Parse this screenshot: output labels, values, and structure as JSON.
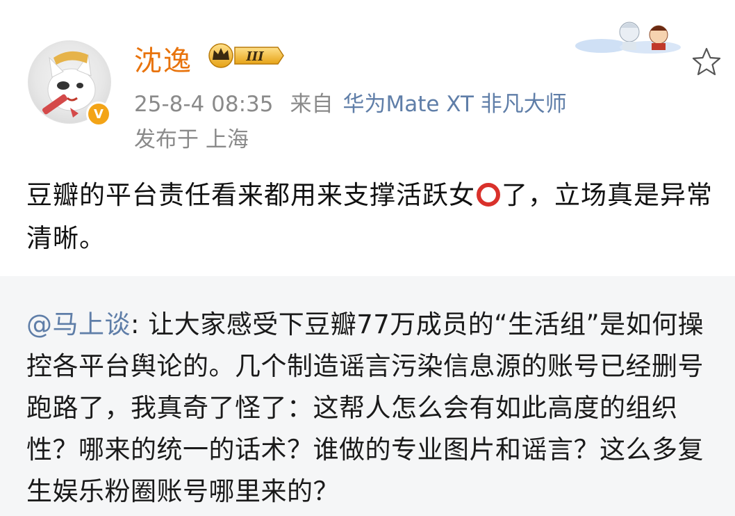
{
  "post": {
    "username": "沈逸",
    "vip_level": "III",
    "timestamp": "25-8-4 08:35",
    "from_label": "来自",
    "device": "华为Mate XT 非凡大师",
    "location": "发布于 上海",
    "content_before_icon": "豆瓣的平台责任看来都用来支撑活跃女",
    "content_after_icon": "了，立场真是异常清晰。",
    "icons": {
      "verified": "verified-v-icon",
      "favorite": "star-outline-icon",
      "inline_emoji": "red-ring-icon"
    }
  },
  "quote": {
    "mention": "@马上谈",
    "text": ": 让大家感受下豆瓣77万成员的“生活组”是如何操控各平台舆论的。几个制造谣言污染信息源的账号已经删号跑路了，我真奇了怪了：这帮人怎么会有如此高度的组织性？哪来的统一的话术？谁做的专业图片和谣言？这么多复生娱乐粉圈账号哪里来的？"
  },
  "colors": {
    "username": "#e8730c",
    "device_link": "#5f7ea8",
    "meta_gray": "#8a8a8a",
    "quote_bg": "#f5f6f7",
    "verified_badge": "#f3a417",
    "ring": "#d9312b"
  }
}
